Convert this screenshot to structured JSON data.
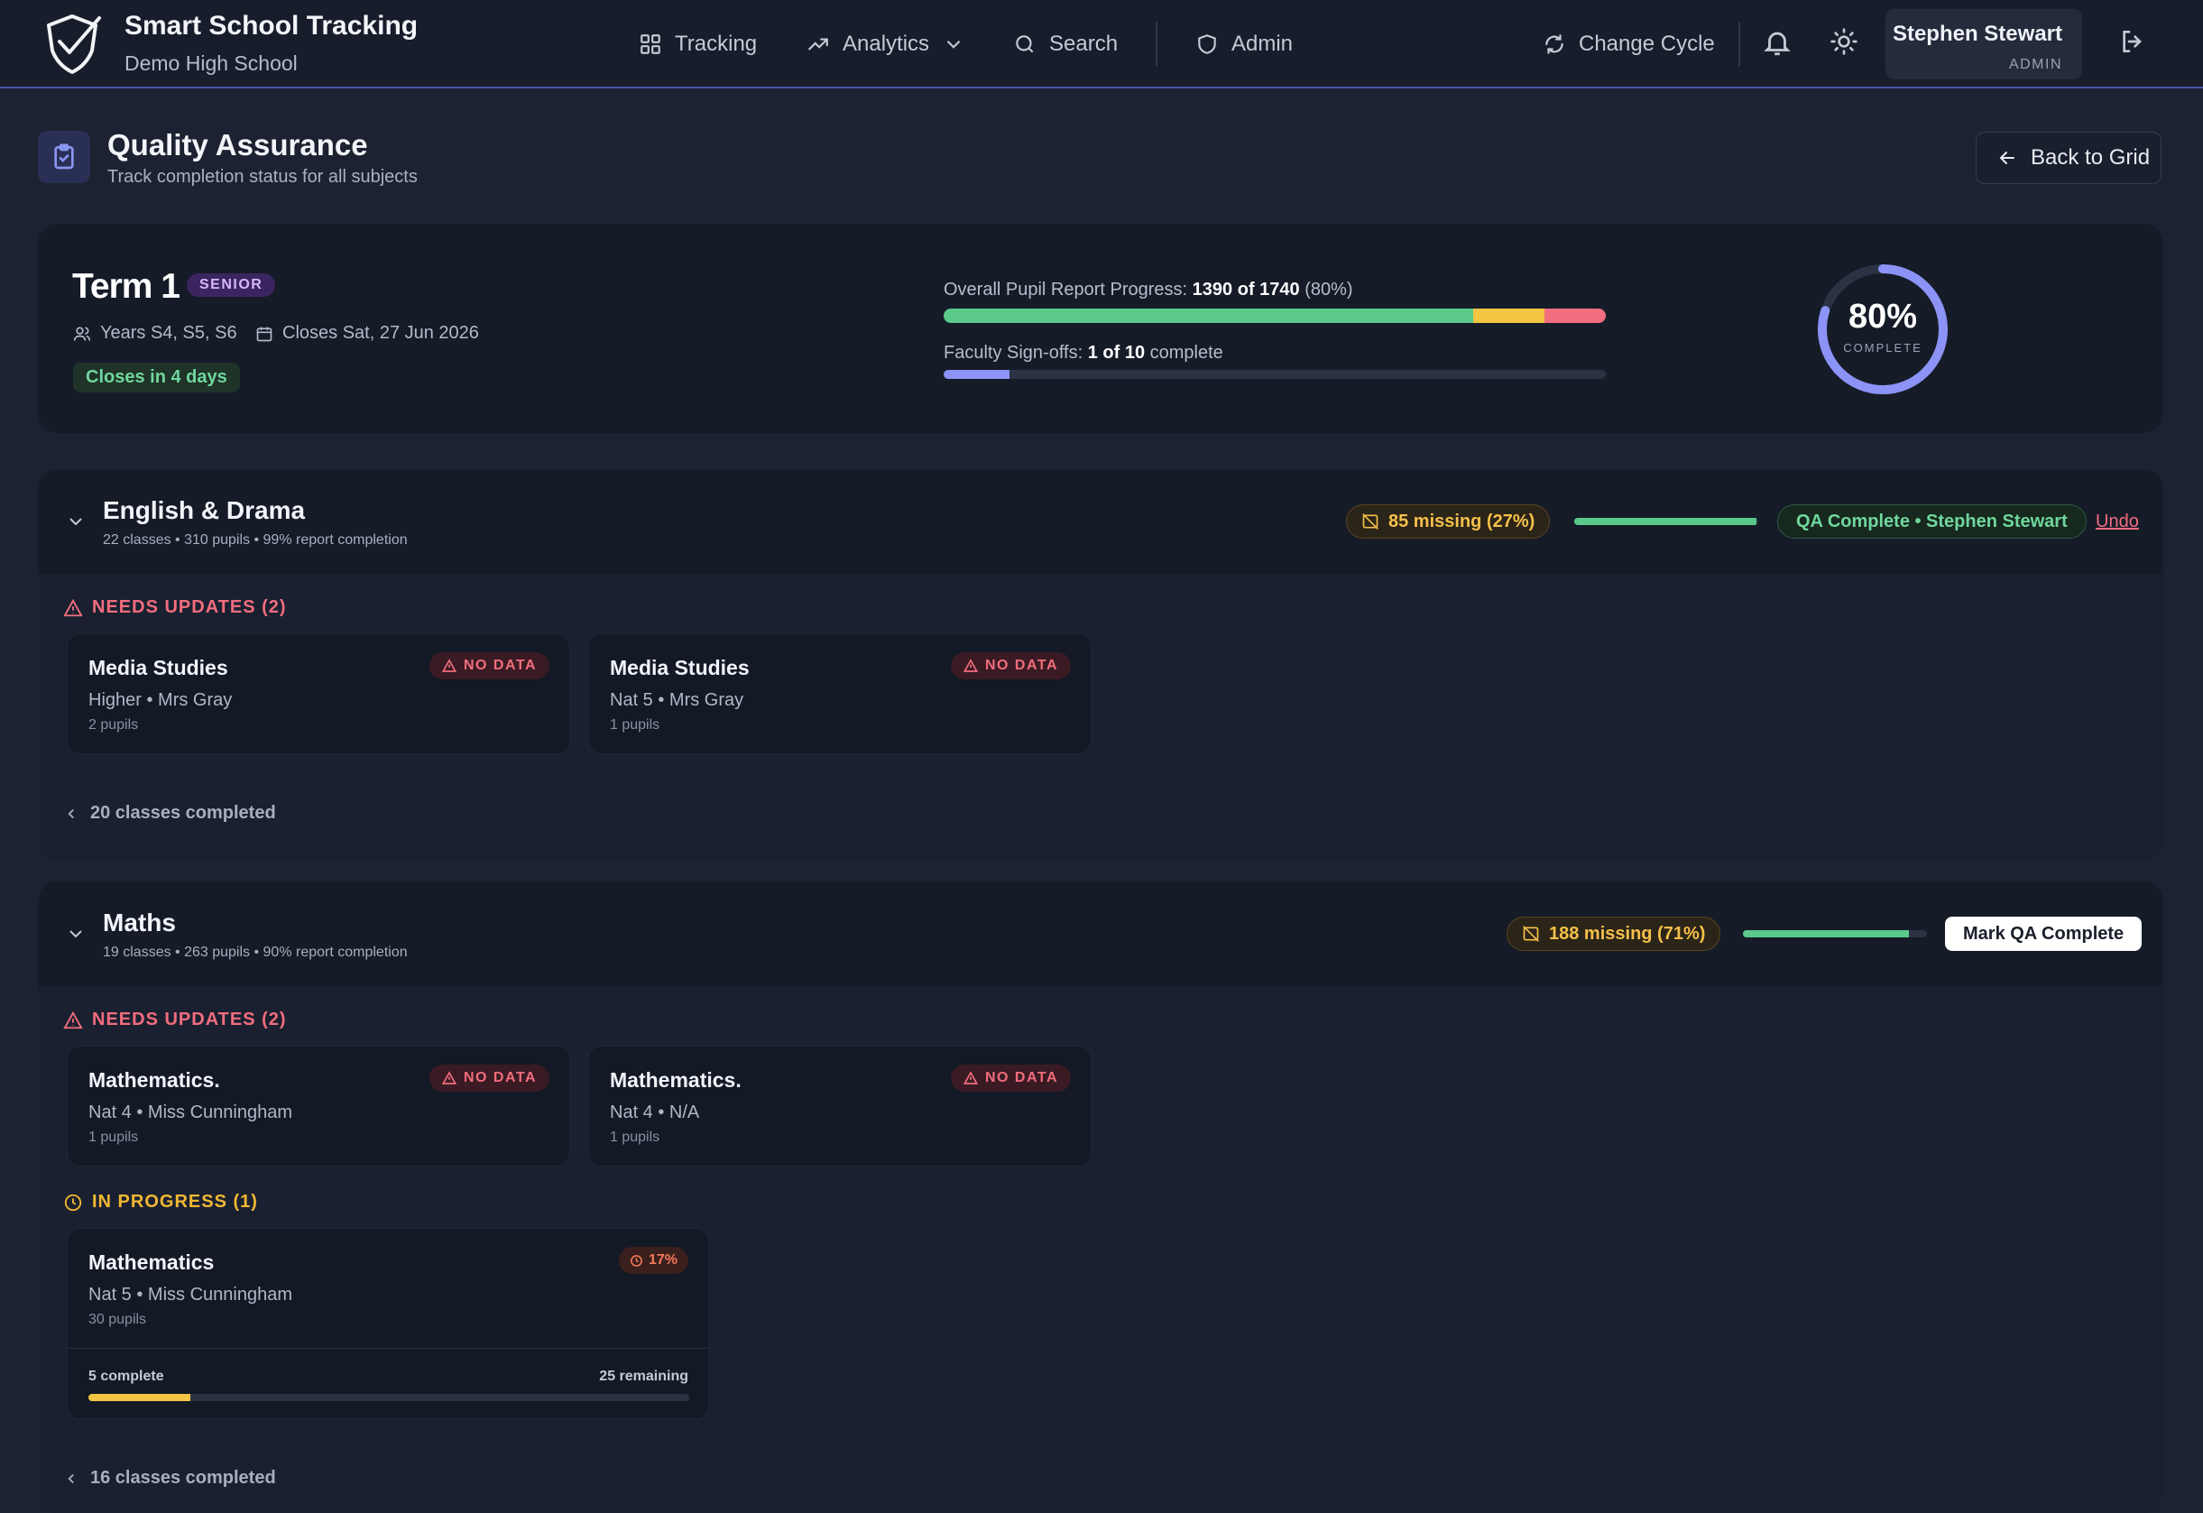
{
  "app": {
    "title": "Smart School Tracking",
    "school": "Demo High School"
  },
  "nav": {
    "tracking": "Tracking",
    "analytics": "Analytics",
    "search": "Search",
    "admin": "Admin",
    "change_cycle": "Change Cycle"
  },
  "user": {
    "name": "Stephen Stewart",
    "role": "ADMIN"
  },
  "page": {
    "title": "Quality Assurance",
    "subtitle": "Track completion status for all subjects",
    "back": "Back to Grid"
  },
  "term": {
    "name": "Term 1",
    "badge": "SENIOR",
    "years": "Years S4, S5, S6",
    "closes": "Closes Sat, 27 Jun 2026",
    "closes_in": "Closes in 4 days",
    "overall_label": "Overall Pupil Report Progress:",
    "overall_counts": "1390 of 1740",
    "overall_pct": "(80%)",
    "overall_segments": {
      "complete": 0.8,
      "in_progress": 0.107,
      "missing": 0.093
    },
    "signoff_label": "Faculty Sign-offs:",
    "signoff_counts": "1 of 10",
    "signoff_suffix": "complete",
    "signoff_fraction": 0.1,
    "ring_value": "80%",
    "ring_caption": "COMPLETE",
    "ring_fraction": 0.8
  },
  "colors": {
    "accent": "#8b93f6",
    "green": "#5ac98a",
    "amber": "#f2c542",
    "red": "#f26d7d"
  },
  "icons": {
    "logo": "shield-check-icon",
    "tracking": "grid-icon",
    "analytics": "trending-up-icon",
    "search": "search-icon",
    "admin": "shield-icon",
    "cycle": "refresh-icon",
    "notifications": "bell-icon",
    "theme": "sun-icon",
    "logout": "logout-icon",
    "page": "clipboard-check-icon"
  },
  "sections": {
    "english": {
      "title": "English & Drama",
      "subtitle": "22 classes • 310 pupils • 99% report completion",
      "missing": "85 missing (27%)",
      "progress": 0.99,
      "qa_status": "QA Complete • Stephen Stewart",
      "undo": "Undo",
      "needs_label": "NEEDS UPDATES (2)",
      "needs": [
        {
          "name": "Media Studies",
          "meta": "Higher • Mrs Gray",
          "pupils": "2 pupils",
          "badge": "NO DATA"
        },
        {
          "name": "Media Studies",
          "meta": "Nat 5 • Mrs Gray",
          "pupils": "1 pupils",
          "badge": "NO DATA"
        }
      ],
      "completed": "20 classes completed"
    },
    "maths": {
      "title": "Maths",
      "subtitle": "19 classes • 263 pupils • 90% report completion",
      "missing": "188 missing (71%)",
      "progress": 0.9,
      "mark": "Mark QA Complete",
      "needs_label": "NEEDS UPDATES (2)",
      "needs": [
        {
          "name": "Mathematics.",
          "meta": "Nat 4 • Miss Cunningham",
          "pupils": "1 pupils",
          "badge": "NO DATA"
        },
        {
          "name": "Mathematics.",
          "meta": "Nat 4 • N/A",
          "pupils": "1 pupils",
          "badge": "NO DATA"
        }
      ],
      "inprog_label": "IN PROGRESS (1)",
      "inprog": {
        "name": "Mathematics",
        "meta": "Nat 5 • Miss Cunningham",
        "pupils": "30 pupils",
        "badge": "17%",
        "complete": "5 complete",
        "remaining": "25 remaining",
        "fraction": 0.17
      },
      "completed": "16 classes completed"
    }
  }
}
